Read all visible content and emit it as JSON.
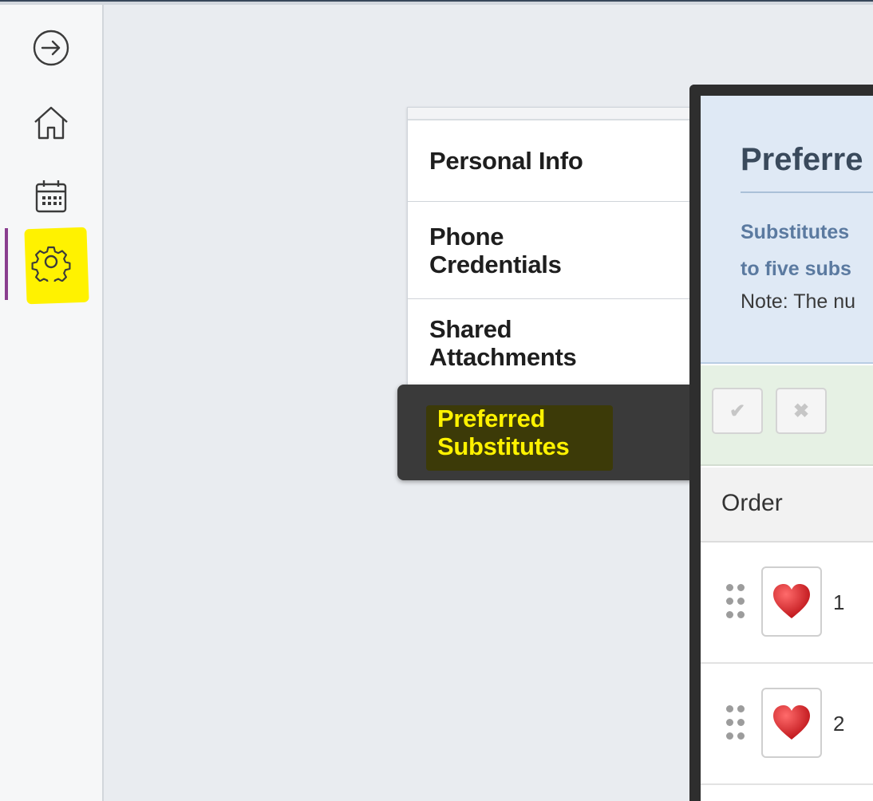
{
  "rail": {
    "icons": [
      "arrow-right-circle-icon",
      "home-icon",
      "calendar-icon",
      "gear-icon"
    ],
    "active": "gear-icon",
    "highlight_color": "#fff200",
    "active_bar_color": "#8a3e8f"
  },
  "settings_nav": {
    "items": [
      {
        "line1": "Personal Info",
        "line2": ""
      },
      {
        "line1": "Phone",
        "line2": "Credentials"
      },
      {
        "line1": "Shared",
        "line2": "Attachments"
      },
      {
        "line1": "Preferred",
        "line2": "Substitutes",
        "active": true
      }
    ]
  },
  "panel": {
    "title": "Preferre",
    "desc_line1": "Substitutes",
    "desc_line2": "to five subs",
    "note": "Note: The nu",
    "toolbar": {
      "check_glyph": "✔",
      "cross_glyph": "✖"
    },
    "columns": [
      "Order"
    ],
    "rows": [
      {
        "order": "1",
        "icon": "heart-icon"
      },
      {
        "order": "2",
        "icon": "heart-icon"
      }
    ],
    "heart_color": "#d32f2f"
  }
}
